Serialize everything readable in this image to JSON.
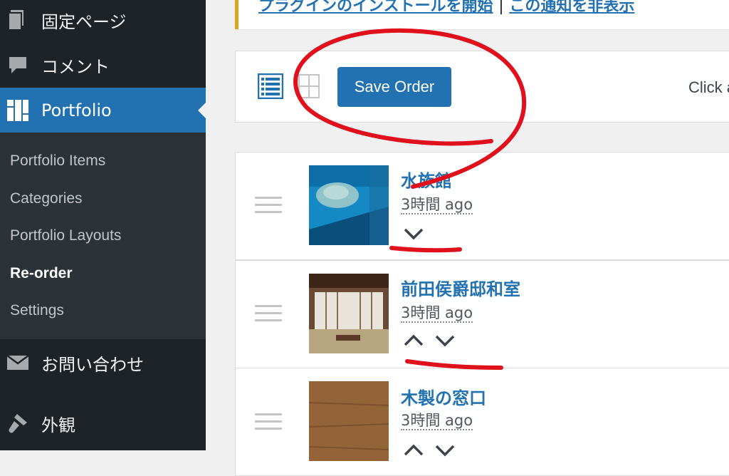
{
  "sidebar": {
    "menu_pages": "固定ページ",
    "menu_comments": "コメント",
    "menu_portfolio": "Portfolio",
    "submenu": [
      "Portfolio Items",
      "Categories",
      "Portfolio Layouts",
      "Re-order",
      "Settings"
    ],
    "menu_contact": "お問い合わせ",
    "menu_appearance": "外観"
  },
  "notice": {
    "install_link": "プラグインのインストールを開始",
    "separator": "|",
    "dismiss_link": "この通知を非表示"
  },
  "toolbar": {
    "save_label": "Save Order",
    "click_text": "Click a"
  },
  "items": [
    {
      "title": "水族館",
      "time": "3時間 ago"
    },
    {
      "title": "前田侯爵邸和室",
      "time": "3時間 ago"
    },
    {
      "title": "木製の窓口",
      "time": "3時間 ago"
    }
  ],
  "colors": {
    "accent": "#2271b1",
    "sidebar": "#1d2327",
    "annotation": "#e0101c"
  }
}
